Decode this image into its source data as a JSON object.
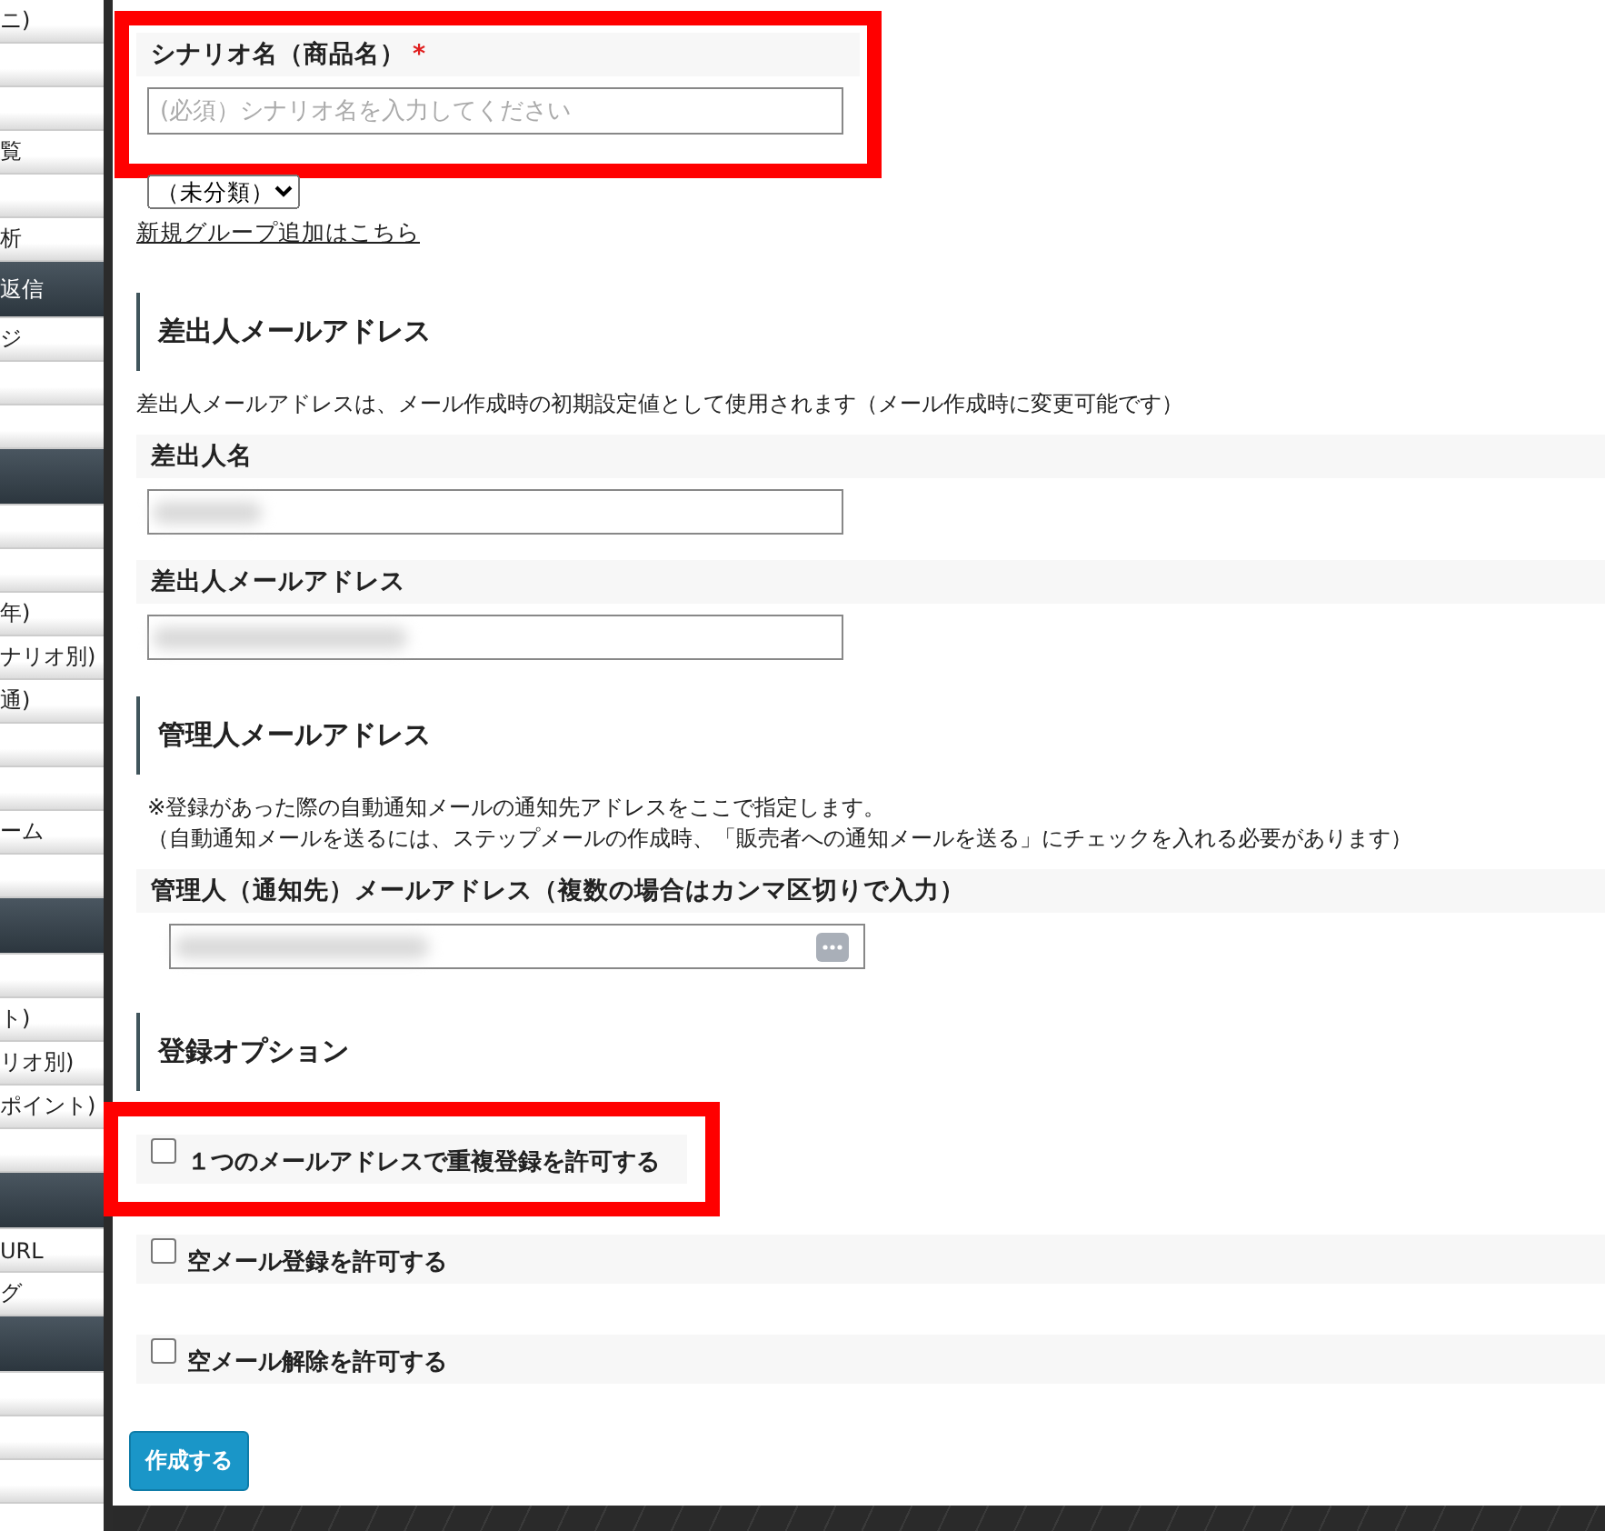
{
  "sidebar": {
    "items": [
      {
        "label": "ニ)",
        "kind": "item"
      },
      {
        "kind": "item"
      },
      {
        "kind": "item"
      },
      {
        "label": "覧",
        "kind": "item"
      },
      {
        "kind": "item"
      },
      {
        "label": "析",
        "kind": "item"
      },
      {
        "label": "返信",
        "kind": "header"
      },
      {
        "label": "ジ",
        "kind": "item"
      },
      {
        "kind": "item"
      },
      {
        "kind": "item"
      },
      {
        "kind": "header"
      },
      {
        "kind": "item"
      },
      {
        "kind": "item"
      },
      {
        "label": "年)",
        "kind": "item"
      },
      {
        "label": "ナリオ別)",
        "kind": "item"
      },
      {
        "label": "通)",
        "kind": "item"
      },
      {
        "kind": "item"
      },
      {
        "kind": "item"
      },
      {
        "label": "ーム",
        "kind": "item"
      },
      {
        "kind": "item"
      },
      {
        "kind": "header"
      },
      {
        "kind": "item"
      },
      {
        "label": "ト)",
        "kind": "item"
      },
      {
        "label": "リオ別)",
        "kind": "item"
      },
      {
        "label": "ポイント)",
        "kind": "item"
      },
      {
        "kind": "item"
      },
      {
        "kind": "header"
      },
      {
        "label": "URL",
        "kind": "item"
      },
      {
        "label": "グ",
        "kind": "item"
      },
      {
        "kind": "header"
      },
      {
        "kind": "item"
      },
      {
        "kind": "item"
      },
      {
        "kind": "item"
      }
    ]
  },
  "scenario": {
    "label": "シナリオ名（商品名）",
    "required_mark": "*",
    "placeholder": "(必須）シナリオ名を入力してください",
    "highlighted": true
  },
  "group": {
    "select": "（未分類）",
    "link": "新規グループ追加はこちら"
  },
  "sections": [
    {
      "heading": "差出人メールアドレス",
      "notes": [
        "差出人メールアドレスは、メール作成時の初期設定値として使用されます（メール作成時に変更可能です）"
      ],
      "fields": [
        {
          "label": "差出人名",
          "redacted": true,
          "wide": false,
          "menu": false
        },
        {
          "label": "差出人メールアドレス",
          "redacted": true,
          "wide": true,
          "menu": false
        }
      ]
    },
    {
      "heading": "管理人メールアドレス",
      "notes": [
        "※登録があった際の自動通知メールの通知先アドレスをここで指定します。",
        "（自動通知メールを送るには、ステップメールの作成時、「販売者への通知メールを送る」にチェックを入れる必要があります）"
      ],
      "fields": [
        {
          "label": "管理人（通知先）メールアドレス（複数の場合はカンマ区切りで入力）",
          "redacted": true,
          "wide": true,
          "menu": true
        }
      ]
    }
  ],
  "options": {
    "heading": "登録オプション",
    "items": [
      {
        "label": "１つのメールアドレスで重複登録を許可する",
        "checked": false,
        "highlighted": true
      },
      {
        "label": "空メール登録を許可する",
        "checked": false,
        "highlighted": false
      },
      {
        "label": "空メール解除を許可する",
        "checked": false,
        "highlighted": false
      }
    ]
  },
  "submit": "作成する"
}
